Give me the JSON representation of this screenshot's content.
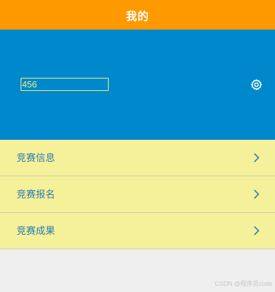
{
  "header": {
    "title": "我的"
  },
  "profile": {
    "name_value": "456",
    "settings_icon": "gear-icon"
  },
  "menu": {
    "items": [
      {
        "label": "竞赛信息",
        "icon": "chevron-right-icon"
      },
      {
        "label": "竞赛报名",
        "icon": "chevron-right-icon"
      },
      {
        "label": "竞赛成果",
        "icon": "chevron-right-icon"
      }
    ]
  },
  "watermark": "CSDN @程序员code",
  "colors": {
    "header": "#ff9900",
    "banner": "#0088cc",
    "menu_background": "#f5f09a",
    "menu_text": "#2a7fb0",
    "input_text": "#f3f37a",
    "page_background": "#efefef"
  }
}
